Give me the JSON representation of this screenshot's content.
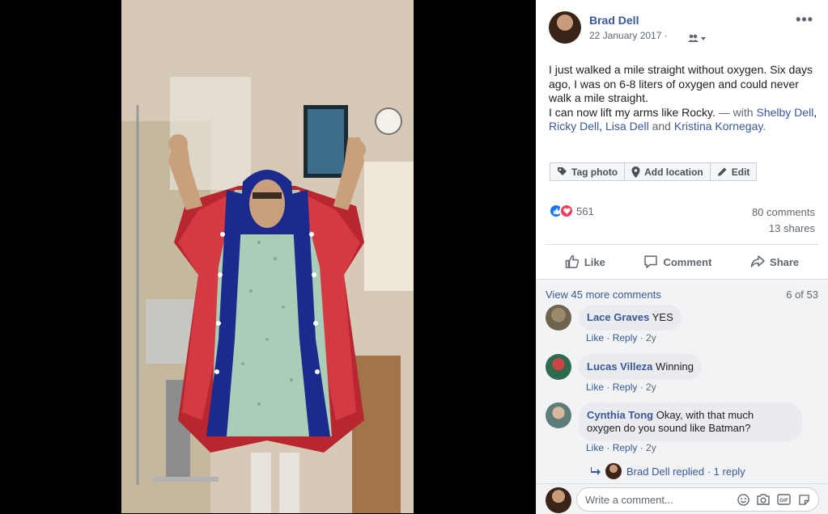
{
  "post": {
    "author": "Brad Dell",
    "date": "22 January 2017",
    "audience_sep": "·",
    "more_label": "•••",
    "text_line1": "I just walked a mile straight without oxygen. Six days ago, I was on 6-8 liters of oxygen and could never walk a mile straight.",
    "text_line2_prefix": "I can now lift my arms like Rocky.",
    "with_label": "— with",
    "tagged": [
      "Shelby Dell",
      "Ricky Dell",
      "Lisa Dell"
    ],
    "and_label": "and",
    "last_tagged": "Kristina Kornegay",
    "end": "."
  },
  "tools": {
    "tag_photo": "Tag photo",
    "add_location": "Add location",
    "edit": "Edit"
  },
  "reactions": {
    "count": "561",
    "comments": "80 comments",
    "shares": "13 shares",
    "like_color": "#1877f2",
    "love_color": "#f33e58"
  },
  "actions": {
    "like": "Like",
    "comment": "Comment",
    "share": "Share"
  },
  "comments_area": {
    "view_more": "View 45 more comments",
    "pager": "6 of 53",
    "items": [
      {
        "name": "Lace Graves",
        "text": "YES",
        "like": "Like",
        "reply": "Reply",
        "age": "2y"
      },
      {
        "name": "Lucas Villeza",
        "text": "Winning",
        "like": "Like",
        "reply": "Reply",
        "age": "2y"
      },
      {
        "name": "Cynthia Tong",
        "text": "Okay, with that much",
        "text2": "oxygen do you sound like Batman?",
        "like": "Like",
        "reply": "Reply",
        "age": "2y"
      }
    ],
    "replied_name": "Brad Dell replied",
    "replied_count": "1 reply",
    "placeholder": "Write a comment..."
  }
}
